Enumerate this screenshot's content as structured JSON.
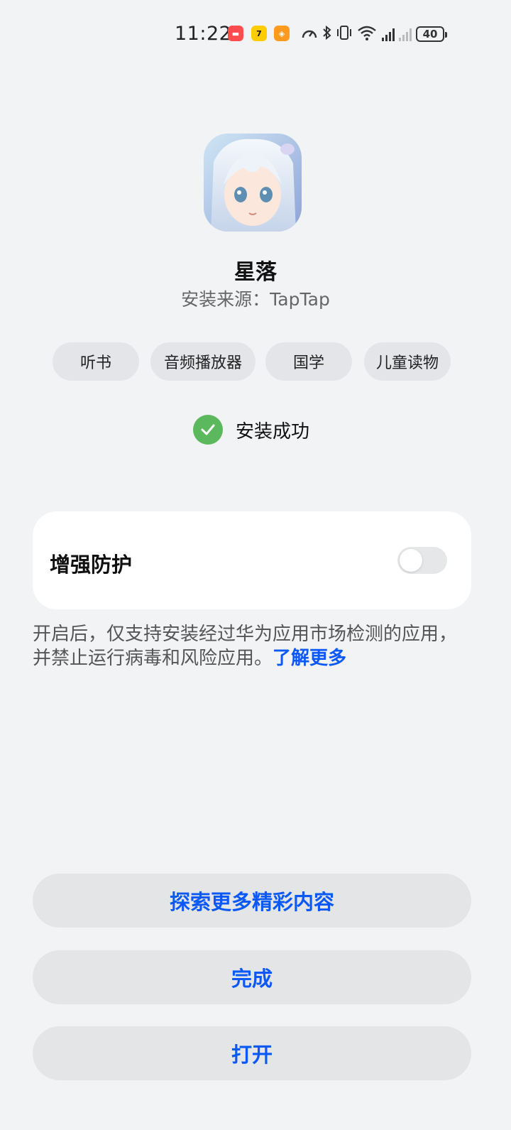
{
  "status_bar": {
    "time": "11:22",
    "notification_badges": [
      "red-app-icon",
      "yellow-app-icon-7",
      "orange-app-icon"
    ],
    "icons": [
      "speed-icon",
      "bluetooth-icon",
      "vibrate-icon",
      "wifi-icon",
      "4g-signal-icon",
      "no-signal-icon"
    ],
    "battery": "40"
  },
  "app": {
    "icon": "anime-girl-app-icon",
    "name": "星落",
    "source": "安装来源：TapTap"
  },
  "tags": [
    "听书",
    "音频播放器",
    "国学",
    "儿童读物"
  ],
  "status": {
    "success_text": "安装成功",
    "success_color": "#5cb85c"
  },
  "protection": {
    "title": "增强防护",
    "enabled": false,
    "description": "开启后，仅支持安装经过华为应用市场检测的应用，并禁止运行病毒和风险应用。",
    "learn_more": "了解更多"
  },
  "buttons": {
    "explore": "探索更多精彩内容",
    "done": "完成",
    "open": "打开"
  },
  "accent_color": "#0a59f7"
}
